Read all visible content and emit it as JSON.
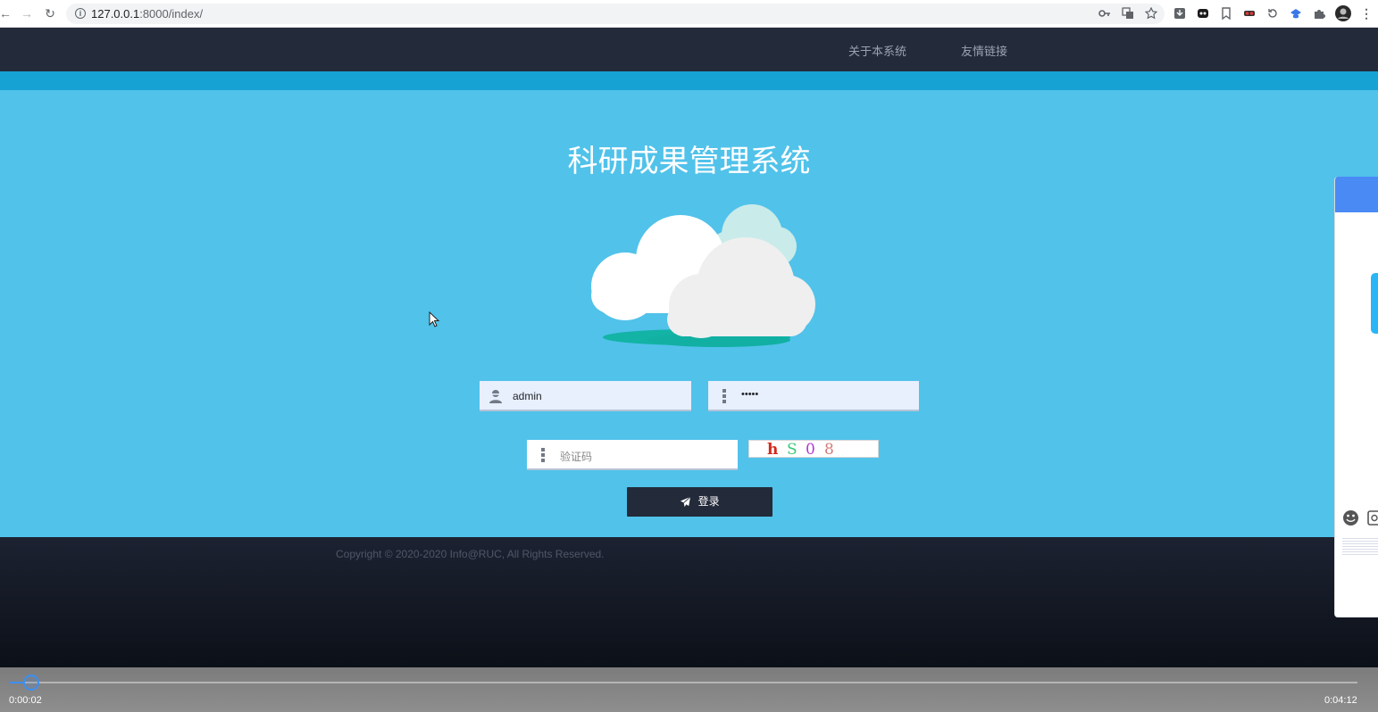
{
  "browser": {
    "url_host": "127.0.0.1",
    "url_path": ":8000/index/",
    "back_label": "←",
    "forward_label": "→",
    "reload_label": "↻",
    "menu_label": "⋮"
  },
  "nav": {
    "links": [
      "关于本系统",
      "友情链接"
    ]
  },
  "hero": {
    "title": "科研成果管理系统"
  },
  "login": {
    "username_value": "admin",
    "password_value": "•••••",
    "captcha_placeholder": "验证码",
    "captcha_chars": [
      "h",
      "S",
      "0",
      "8"
    ],
    "captcha_colors": [
      "#d2291b",
      "#3cc87a",
      "#b33ad1",
      "#d27a7a"
    ],
    "login_label": "登录"
  },
  "footer": {
    "copyright": "Copyright © 2020-2020 Info@RUC, All Rights Reserved."
  },
  "player": {
    "elapsed": "0:00:02",
    "duration": "0:04:12",
    "progress": 0.008
  },
  "colors": {
    "nav_bg": "#232a3a",
    "hero_bg": "#51c2ea",
    "stripe": "#17a2d4",
    "accent_blue": "#3d8ff0"
  },
  "icons": {
    "username": "user-icon",
    "password": "lock-icon",
    "captcha": "key-icon",
    "login": "paper-plane-icon"
  }
}
